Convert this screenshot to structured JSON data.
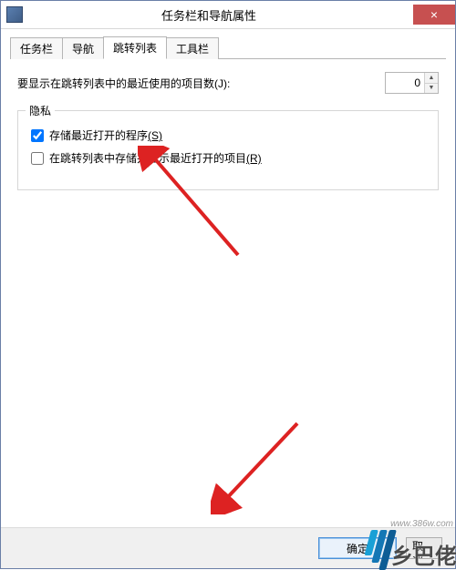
{
  "titlebar": {
    "title": "任务栏和导航属性",
    "close_icon": "×"
  },
  "tabs": [
    {
      "label": "任务栏",
      "active": false
    },
    {
      "label": "导航",
      "active": false
    },
    {
      "label": "跳转列表",
      "active": true
    },
    {
      "label": "工具栏",
      "active": false
    }
  ],
  "jump_list": {
    "count_label": "要显示在跳转列表中的最近使用的项目数(J):",
    "count_value": "0"
  },
  "privacy_group": {
    "legend": "隐私",
    "store_programs": {
      "checked": true,
      "label_main": "存储最近打开的程序",
      "label_accel": "(S)"
    },
    "store_items": {
      "checked": false,
      "label_main": "在跳转列表中存储并显示最近打开的项目",
      "label_accel": "(R)"
    }
  },
  "buttons": {
    "ok": "确定",
    "cancel": "取消"
  },
  "watermark": {
    "text": "乡巴佬",
    "url": "www.386w.com"
  }
}
